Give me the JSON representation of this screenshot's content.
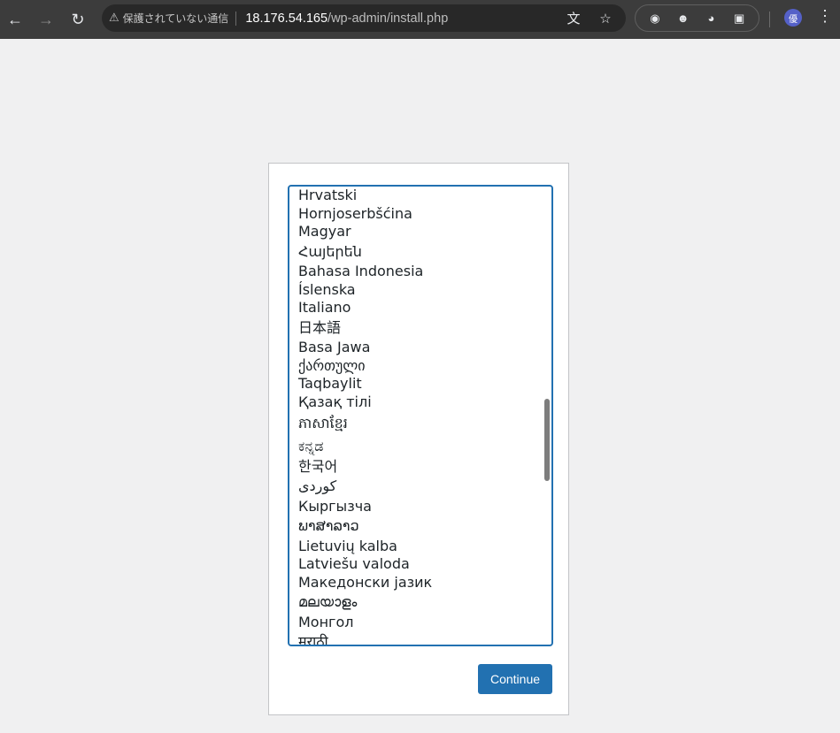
{
  "browser": {
    "security_label": "保護されていない通信",
    "url_host": "18.176.54.165",
    "url_path": "/wp-admin/install.php",
    "profile_initial": "優"
  },
  "installer": {
    "languages": [
      "Hrvatski",
      "Hornjoserbšćina",
      "Magyar",
      "Հայերեն",
      "Bahasa Indonesia",
      "Íslenska",
      "Italiano",
      "日本語",
      "Basa Jawa",
      "ქართული",
      "Taqbaylit",
      "Қазақ тілі",
      "ភាសាខ្មែរ",
      "ಕನ್ನಡ",
      "한국어",
      "كوردی",
      "Кыргызча",
      "ພາສາລາວ",
      "Lietuvių kalba",
      "Latviešu valoda",
      "Македонски јазик",
      "മലയാളം",
      "Монгол",
      "मराठी"
    ],
    "continue_label": "Continue"
  }
}
